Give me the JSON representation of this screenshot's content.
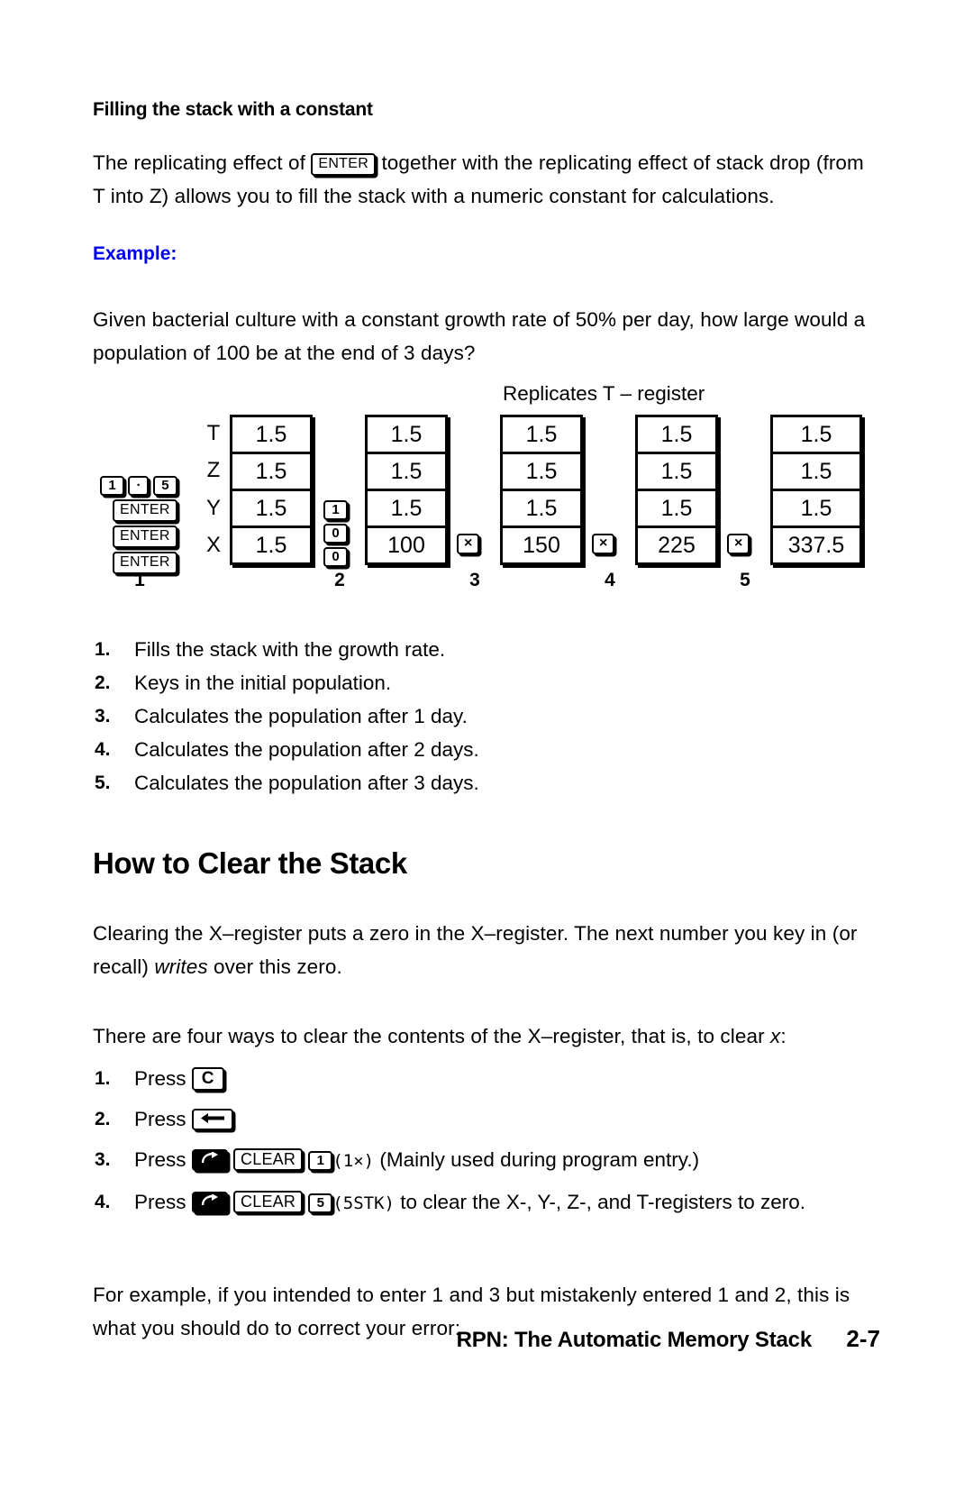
{
  "section": {
    "sub_heading": "Filling the stack with a constant",
    "intro_before_key": "The replicating effect of",
    "intro_key": "ENTER",
    "intro_after_key": "together with the replicating effect of stack drop (from T into Z) allows you to fill the stack with a numeric constant for calculations.",
    "example_label": "Example:",
    "example_text": "Given bacterial culture with a constant growth rate of 50% per day, how large would a population of 100 be at the end of 3 days?"
  },
  "diagram": {
    "note": "Replicates T – register",
    "register_labels": [
      "T",
      "Z",
      "Y",
      "X"
    ],
    "entry_keys_step1": [
      "1",
      "·",
      "5",
      "ENTER",
      "ENTER",
      "ENTER"
    ],
    "entry_keys_step2": [
      "1",
      "0",
      "0"
    ],
    "operator_keys": [
      "×",
      "×",
      "×"
    ],
    "stacks": [
      {
        "id": 1,
        "cells": [
          "1.5",
          "1.5",
          "1.5",
          "1.5"
        ]
      },
      {
        "id": 2,
        "cells": [
          "1.5",
          "1.5",
          "1.5",
          "100"
        ]
      },
      {
        "id": 3,
        "cells": [
          "1.5",
          "1.5",
          "1.5",
          "150"
        ]
      },
      {
        "id": 4,
        "cells": [
          "1.5",
          "1.5",
          "1.5",
          "225"
        ]
      },
      {
        "id": 5,
        "cells": [
          "1.5",
          "1.5",
          "1.5",
          "337.5"
        ]
      }
    ],
    "step_numbers": [
      "1",
      "2",
      "3",
      "4",
      "5"
    ]
  },
  "steps": [
    {
      "num": "1.",
      "text": "Fills the stack with the growth rate."
    },
    {
      "num": "2.",
      "text": "Keys in the initial population."
    },
    {
      "num": "3.",
      "text": "Calculates the population after 1 day."
    },
    {
      "num": "4.",
      "text": "Calculates the population after 2 days."
    },
    {
      "num": "5.",
      "text": "Calculates the population after 3 days."
    }
  ],
  "clear_section": {
    "heading": "How to Clear the Stack",
    "para1_a": "Clearing the X–register puts a zero in the X–register. The next number you key in (or recall)",
    "para1_italic": "writes",
    "para1_b": "over this zero.",
    "para2": "There are four ways to clear the contents of the X–register, that is, to clear",
    "para2_italic": "x",
    "para2_end": ":",
    "press_word": "Press",
    "items": [
      {
        "num": "1.",
        "keys": [
          "C"
        ],
        "suffix": ""
      },
      {
        "num": "2.",
        "keys": [
          "←"
        ],
        "suffix": ""
      },
      {
        "num": "3.",
        "keys": [
          "shift",
          "CLEAR",
          "1"
        ],
        "code": "(1×)",
        "suffix": "(Mainly used during program entry.)"
      },
      {
        "num": "4.",
        "keys": [
          "shift",
          "CLEAR",
          "5"
        ],
        "code": "(5STK)",
        "suffix": "to clear the X-, Y-, Z-, and T-registers to zero."
      }
    ],
    "closing": "For example, if you intended to enter 1 and 3 but mistakenly entered 1 and 2, this is what you should do to correct your error:"
  },
  "footer": {
    "title": "RPN: The Automatic Memory Stack",
    "page": "2-7"
  },
  "colors": {
    "example_blue": "#0000ee",
    "ink": "#000000",
    "paper": "#ffffff"
  }
}
